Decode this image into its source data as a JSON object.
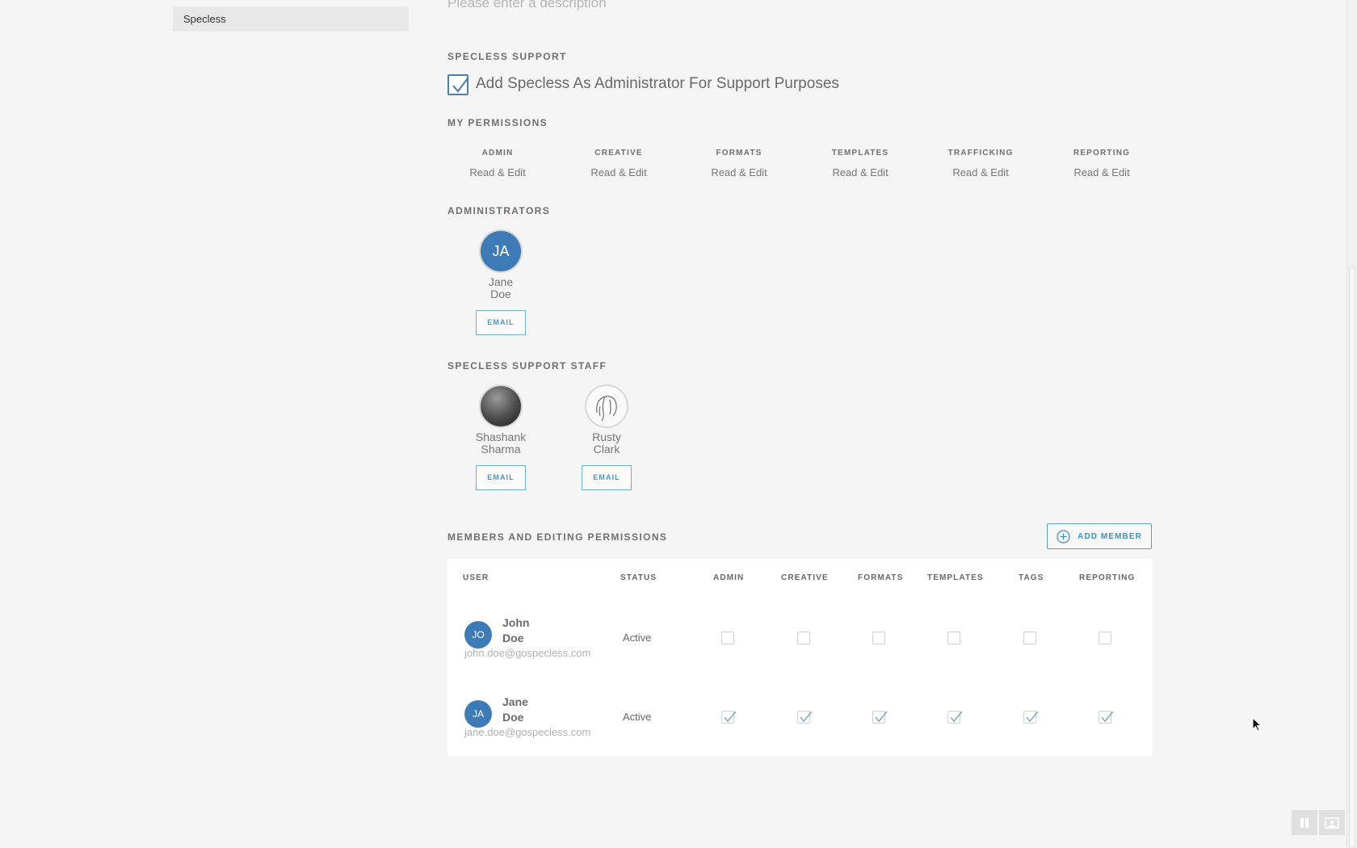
{
  "sidebar": {
    "items": [
      {
        "label": "Specless"
      }
    ]
  },
  "description": {
    "placeholder": "Please enter a description"
  },
  "specless_support": {
    "title": "SPECLESS SUPPORT",
    "checkbox_label": "Add Specless As Administrator For Support Purposes",
    "checked": true
  },
  "my_permissions": {
    "title": "MY PERMISSIONS",
    "columns": [
      {
        "header": "ADMIN",
        "value": "Read & Edit"
      },
      {
        "header": "CREATIVE",
        "value": "Read & Edit"
      },
      {
        "header": "FORMATS",
        "value": "Read & Edit"
      },
      {
        "header": "TEMPLATES",
        "value": "Read & Edit"
      },
      {
        "header": "TRAFFICKING",
        "value": "Read & Edit"
      },
      {
        "header": "REPORTING",
        "value": "Read & Edit"
      }
    ]
  },
  "administrators": {
    "title": "ADMINISTRATORS",
    "people": [
      {
        "initials": "JA",
        "first": "Jane",
        "last": "Doe",
        "email_label": "EMAIL"
      }
    ]
  },
  "support_staff": {
    "title": "SPECLESS SUPPORT STAFF",
    "people": [
      {
        "first": "Shashank",
        "last": "Sharma",
        "email_label": "EMAIL"
      },
      {
        "first": "Rusty",
        "last": "Clark",
        "email_label": "EMAIL"
      }
    ]
  },
  "members": {
    "title": "MEMBERS AND EDITING PERMISSIONS",
    "add_button": "ADD MEMBER",
    "headers": [
      "USER",
      "STATUS",
      "ADMIN",
      "CREATIVE",
      "FORMATS",
      "TEMPLATES",
      "TAGS",
      "REPORTING"
    ],
    "rows": [
      {
        "initials": "JO",
        "first": "John",
        "last": "Doe",
        "email": "john.doe@gospecless.com",
        "status": "Active",
        "perms": [
          false,
          false,
          false,
          false,
          false,
          false
        ]
      },
      {
        "initials": "JA",
        "first": "Jane",
        "last": "Doe",
        "email": "jane.doe@gospecless.com",
        "status": "Active",
        "perms": [
          true,
          true,
          true,
          true,
          true,
          true
        ]
      }
    ]
  },
  "colors": {
    "accent": "#3e7ab5",
    "button_border": "#6fb0cf",
    "background": "#f5f5f5"
  }
}
